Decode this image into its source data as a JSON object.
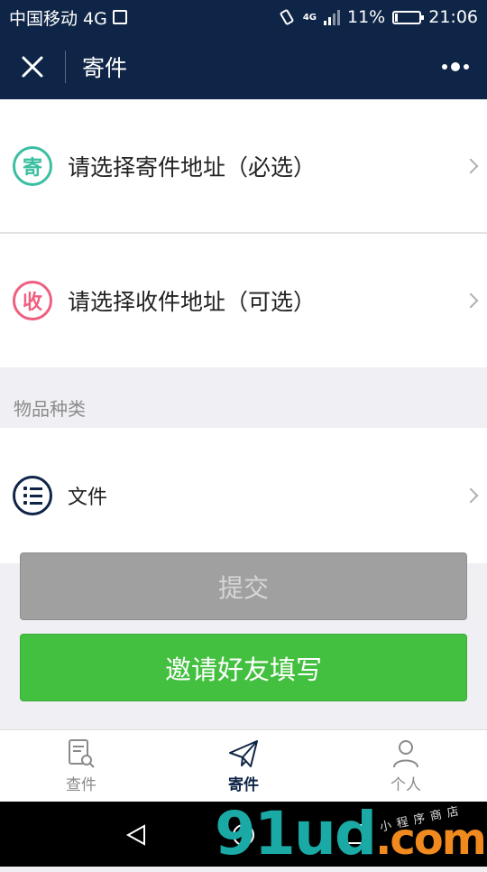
{
  "status_bar": {
    "carrier": "中国移动 4G",
    "network_badge": "4G",
    "battery": "11%",
    "battery_level": 0.11,
    "time": "21:06"
  },
  "nav": {
    "title": "寄件"
  },
  "sender_row": {
    "icon_char": "寄",
    "label": "请选择寄件地址（必选）",
    "accent": "#3bbfa0"
  },
  "receiver_row": {
    "icon_char": "收",
    "label": "请选择收件地址（可选）",
    "accent": "#ef5f7f"
  },
  "category": {
    "section_label": "物品种类",
    "value": "文件"
  },
  "buttons": {
    "submit": "提交",
    "invite": "邀请好友填写"
  },
  "tabs": [
    {
      "label": "查件",
      "icon": "search-document-icon",
      "active": false
    },
    {
      "label": "寄件",
      "icon": "paper-plane-icon",
      "active": true
    },
    {
      "label": "个人",
      "icon": "person-icon",
      "active": false
    }
  ],
  "watermark": {
    "main": "91ud",
    "suffix": ".com",
    "sub": "小程序商店"
  },
  "colors": {
    "nav_bg": "#0f2547",
    "primary_green": "#43c03f",
    "disabled_gray": "#a0a0a0"
  }
}
